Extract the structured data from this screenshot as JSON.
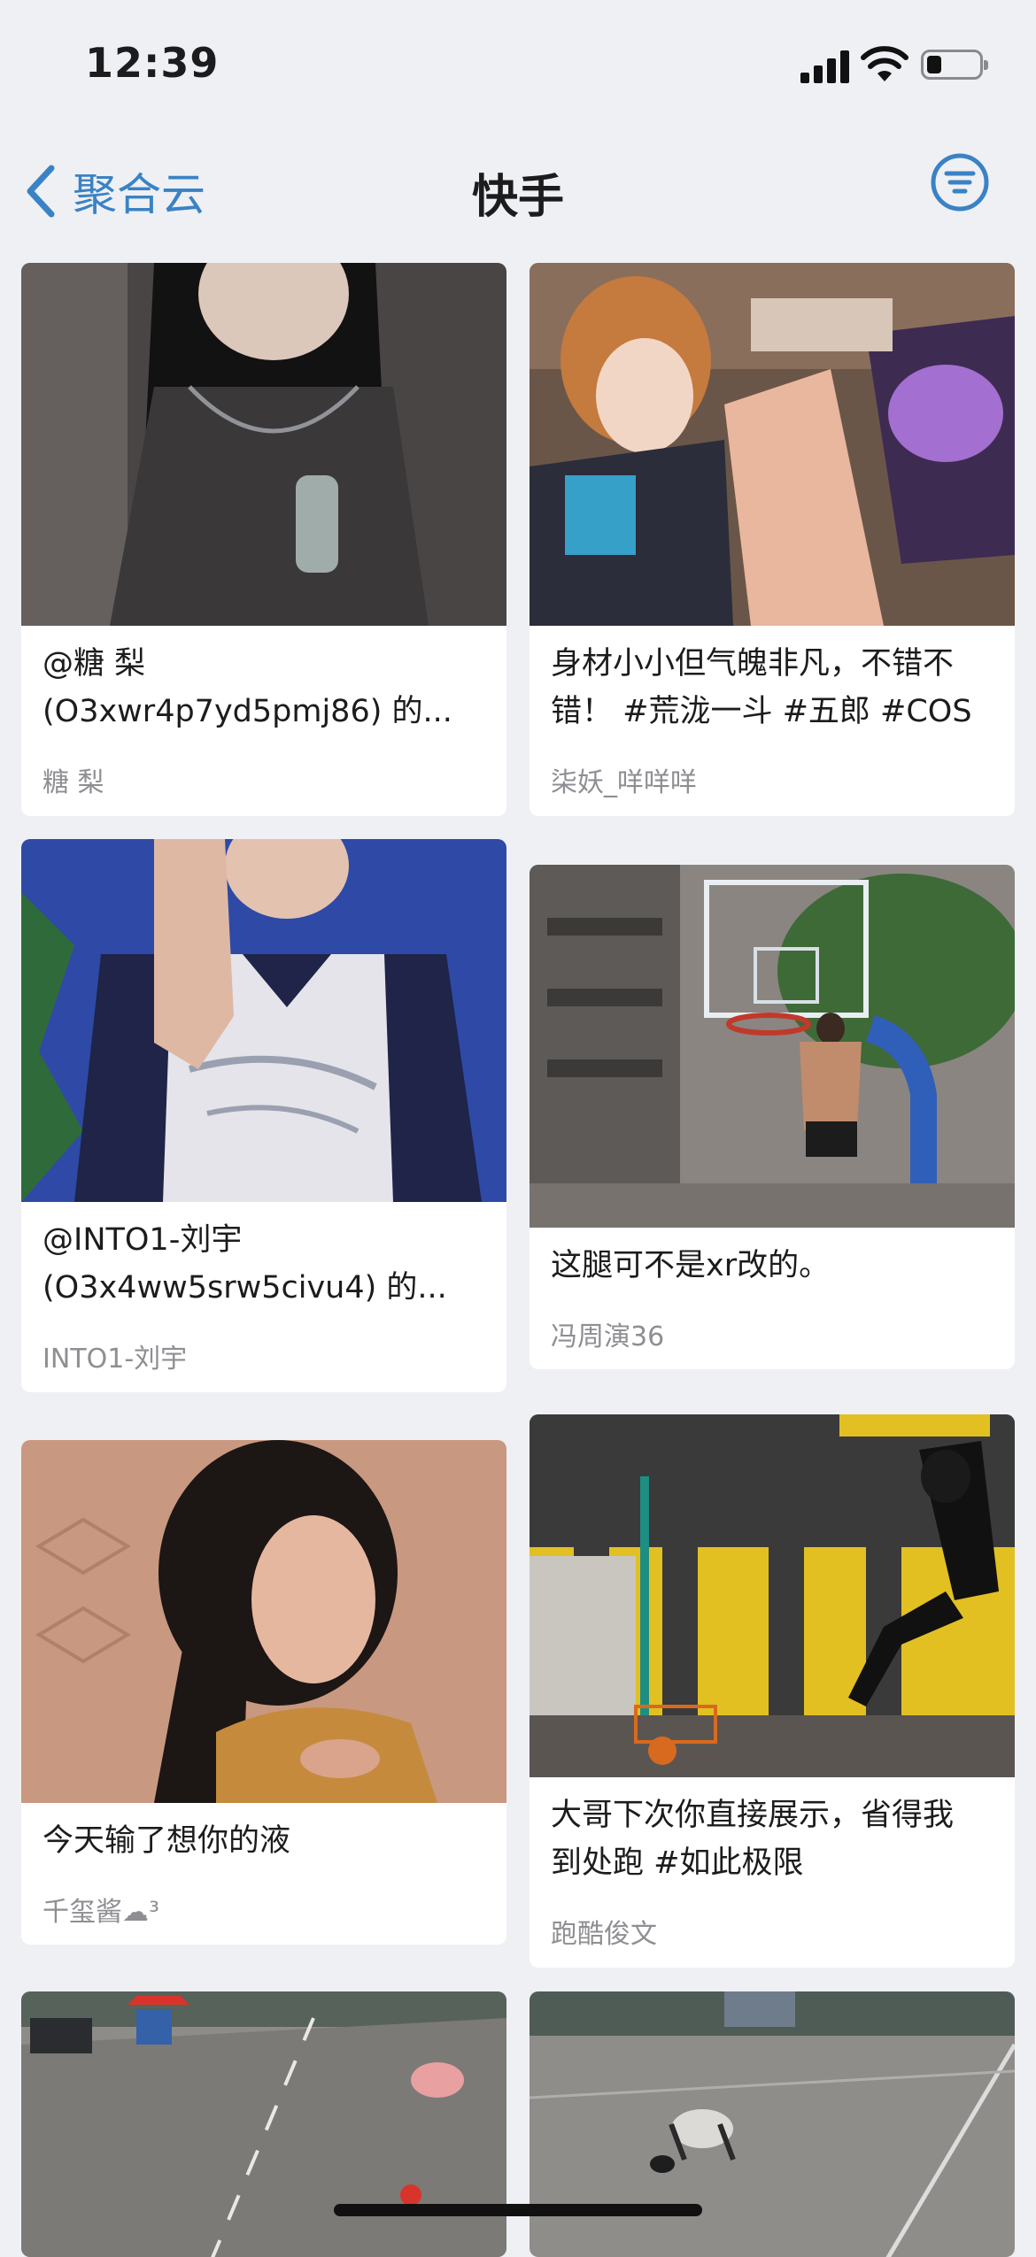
{
  "status": {
    "time": "12:39"
  },
  "nav": {
    "back_label": "聚合云",
    "title": "快手"
  },
  "cards": [
    {
      "title_line1": "@糖 梨",
      "title_line2": "(O3xwr4p7yd5pmj86) 的...",
      "author": "糖 梨"
    },
    {
      "title_line1": "身材小小但气魄非凡，不错不",
      "title_line2": "错！ #荒泷一斗 #五郎 #COS",
      "author": "柒妖_咩咩咩"
    },
    {
      "title_line1": "@INTO1-刘宇",
      "title_line2": "(O3x4ww5srw5civu4) 的...",
      "author": "INTO1-刘宇"
    },
    {
      "title_line1": "这腿可不是xr改的。",
      "author": "冯周演36"
    },
    {
      "title_line1": "今天输了想你的液",
      "author": "千玺酱☁︎³"
    },
    {
      "title_line1": "大哥下次你直接展示，省得我",
      "title_line2": "到处跑 #如此极限",
      "author": "跑酷俊文"
    }
  ],
  "colors": {
    "accent": "#3b82c4",
    "background": "#eef0f4",
    "card": "#ffffff",
    "secondary_text": "#8e8e93"
  }
}
